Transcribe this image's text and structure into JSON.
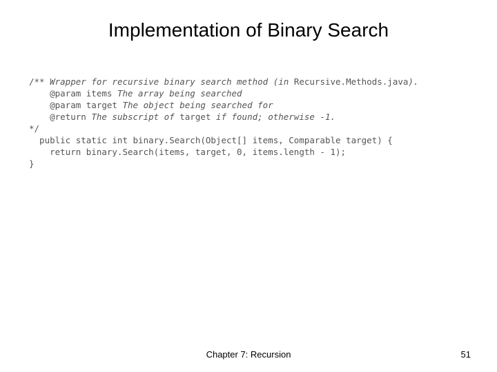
{
  "title": "Implementation of Binary Search",
  "code": {
    "l1a": "/** ",
    "l1b": "Wrapper for recursive binary search method (in ",
    "l1c": "Recursive.Methods.java",
    "l1d": ").",
    "l2a": "    @param items ",
    "l2b": "The array being searched",
    "l3a": "    @param target ",
    "l3b": "The object being searched for",
    "l4a": "    @return ",
    "l4b": "The subscript of ",
    "l4c": "target",
    "l4d": " if found; otherwise -1.",
    "l5": "*/",
    "l6": "  public static int binary.Search(Object[] items, Comparable target) {",
    "l7": "    return binary.Search(items, target, 0, items.length - 1);",
    "l8": "}"
  },
  "footer": {
    "center": "Chapter 7: Recursion",
    "page": "51"
  }
}
